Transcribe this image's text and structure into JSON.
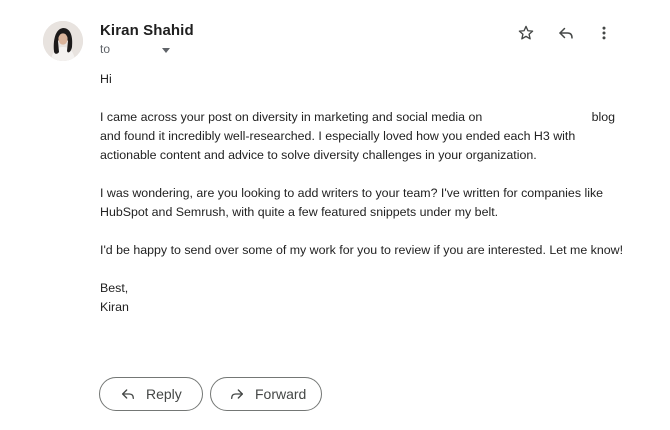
{
  "email": {
    "sender_name": "Kiran Shahid",
    "to_label": "to",
    "greeting": "Hi",
    "paragraph1_line1": "I came across your post on diversity in marketing and social media on",
    "paragraph1_blog": "blog",
    "paragraph1_rest": "and found it incredibly well-researched. I especially loved how you ended each H3 with actionable content and advice to solve diversity challenges in your organization.",
    "paragraph2": "I was wondering, are you looking to add writers to your team? I've written for companies like HubSpot and Semrush, with quite a few featured snippets under my belt.",
    "paragraph3": "I'd be happy to send over some of my work for you to review if you are interested. Let me know!",
    "signoff": "Best,",
    "signature": "Kiran"
  },
  "actions": {
    "reply_label": "Reply",
    "forward_label": "Forward"
  },
  "icons": {
    "star": "star-icon",
    "reply": "reply-icon",
    "more": "more-vert-icon",
    "forward": "forward-icon"
  }
}
